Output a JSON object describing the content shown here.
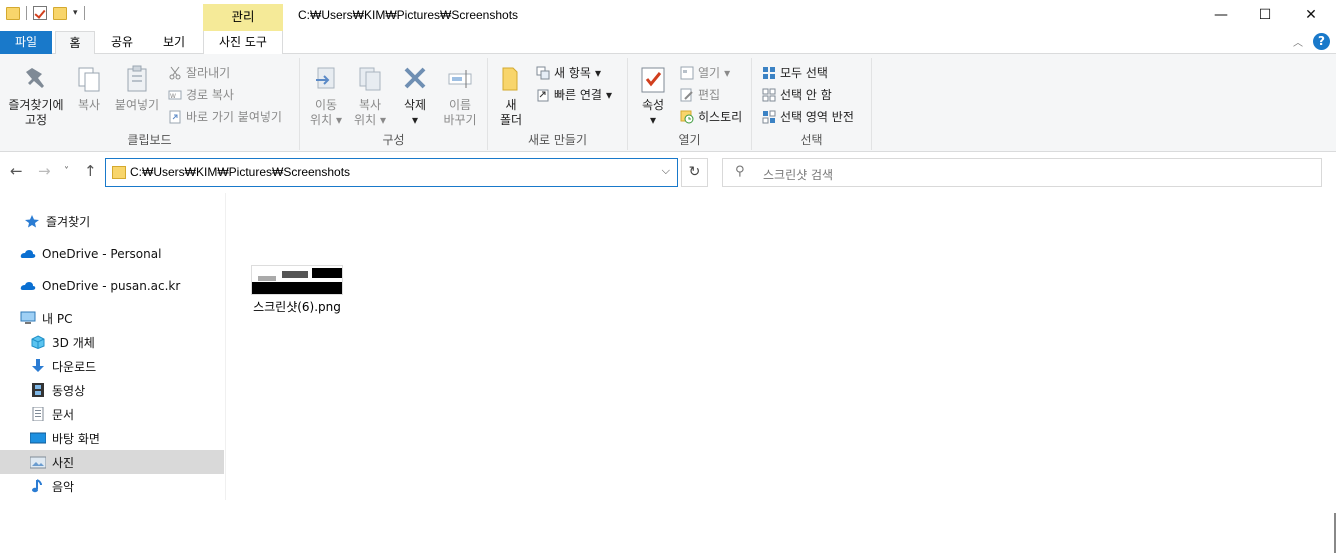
{
  "titlebar": {
    "manage_tab": "관리",
    "window_title": "C:₩Users₩KIM₩Pictures₩Screenshots",
    "minimize": "—",
    "maximize": "☐",
    "close": "✕"
  },
  "tabs": {
    "file": "파일",
    "home": "홈",
    "share": "공유",
    "view": "보기",
    "picture_tools": "사진 도구"
  },
  "ribbon": {
    "clipboard": {
      "label": "클립보드",
      "pin_line1": "즐겨찾기에",
      "pin_line2": "고정",
      "copy": "복사",
      "paste": "붙여넣기",
      "cut": "잘라내기",
      "copy_path": "경로 복사",
      "paste_shortcut": "바로 가기 붙여넣기"
    },
    "organize": {
      "label": "구성",
      "move_line1": "이동",
      "move_line2": "위치",
      "copy_line1": "복사",
      "copy_line2": "위치",
      "delete": "삭제",
      "rename_line1": "이름",
      "rename_line2": "바꾸기"
    },
    "new": {
      "label": "새로 만들기",
      "new_folder_line1": "새",
      "new_folder_line2": "폴더",
      "new_item": "새 항목",
      "easy_access": "빠른 연결"
    },
    "open": {
      "label": "열기",
      "properties": "속성",
      "open": "열기",
      "edit": "편집",
      "history": "히스토리"
    },
    "select": {
      "label": "선택",
      "select_all": "모두 선택",
      "select_none": "선택 안 함",
      "invert": "선택 영역 반전"
    }
  },
  "address": {
    "path": "C:₩Users₩KIM₩Pictures₩Screenshots",
    "search_placeholder": "스크린샷 검색"
  },
  "nav": {
    "items": [
      {
        "label": "즐겨찾기"
      },
      {
        "label": "OneDrive - Personal"
      },
      {
        "label": "OneDrive - pusan.ac.kr"
      },
      {
        "label": "내 PC"
      },
      {
        "label": "3D 개체"
      },
      {
        "label": "다운로드"
      },
      {
        "label": "동영상"
      },
      {
        "label": "문서"
      },
      {
        "label": "바탕 화면"
      },
      {
        "label": "사진"
      },
      {
        "label": "음악"
      }
    ],
    "selected": "사진"
  },
  "files": [
    {
      "name": "스크린샷(6).png"
    }
  ],
  "colors": {
    "accent": "#1979ca",
    "manage_tab": "#f5ea98",
    "ribbon_bg": "#f5f6f7",
    "selected_nav": "#d9d9d9"
  }
}
